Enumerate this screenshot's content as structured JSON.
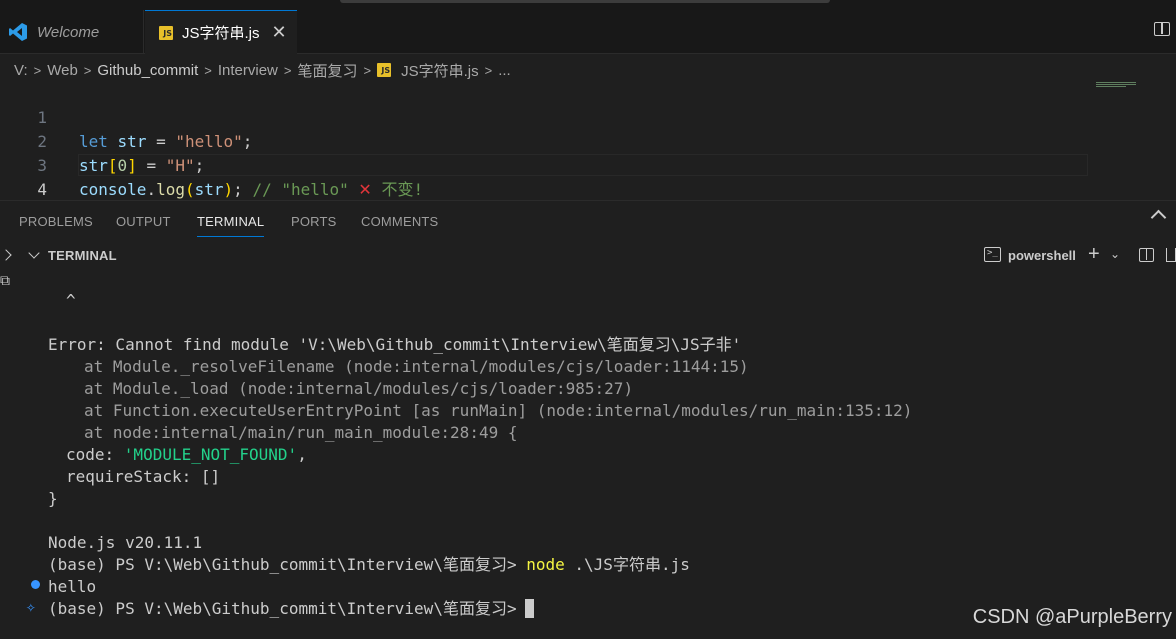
{
  "tabs": [
    {
      "label": "Welcome",
      "icon": "vscode-logo-icon"
    },
    {
      "label": "JS字符串.js",
      "icon": "js-file-icon",
      "active": true,
      "close": "✕"
    }
  ],
  "js_badge": "JS",
  "breadcrumb": [
    "V:",
    "Web",
    "Github_commit",
    "Interview",
    "笔面复习",
    "JS字符串.js",
    "..."
  ],
  "editor": {
    "line_numbers": [
      "1",
      "2",
      "3",
      "4"
    ],
    "line1": {
      "kw": "let",
      "var": "str",
      "eq": " = ",
      "str": "\"hello\"",
      "semi": ";"
    },
    "line2": {
      "var": "str",
      "b1": "[",
      "num": "0",
      "b2": "]",
      "eq": " = ",
      "str": "\"H\"",
      "semi": ";"
    },
    "line3": {
      "obj": "console",
      "dot": ".",
      "fn": "log",
      "p1": "(",
      "arg": "str",
      "p2": ")",
      "semi": ";",
      "comment": "// \"hello\"",
      "mark": "✕",
      "note": "不变!"
    }
  },
  "panel_tabs": [
    "PROBLEMS",
    "OUTPUT",
    "TERMINAL",
    "PORTS",
    "COMMENTS"
  ],
  "active_panel_tab": "TERMINAL",
  "terminal_header": {
    "title": "TERMINAL",
    "shell": "powershell",
    "ps_glyph": ">_"
  },
  "terminal": {
    "caret": "^",
    "error": "Error: Cannot find module 'V:\\Web\\Github_commit\\Interview\\笔面复习\\JS子非'",
    "stack": [
      "at Module._resolveFilename (node:internal/modules/cjs/loader:1144:15)",
      "at Module._load (node:internal/modules/cjs/loader:985:27)",
      "at Function.executeUserEntryPoint [as runMain] (node:internal/modules/run_main:135:12)",
      "at node:internal/main/run_main_module:28:49 {"
    ],
    "code_key": "code: ",
    "code_val": "'MODULE_NOT_FOUND'",
    "code_end": ",",
    "require_stack": "requireStack: []",
    "close_brace": "}",
    "node_version": "Node.js v20.11.1",
    "prompt": "(base) PS V:\\Web\\Github_commit\\Interview\\笔面复习>",
    "command": "node",
    "command_arg": ".\\JS字符串.js",
    "output": "hello"
  },
  "watermark": "CSDN @aPurpleBerry"
}
